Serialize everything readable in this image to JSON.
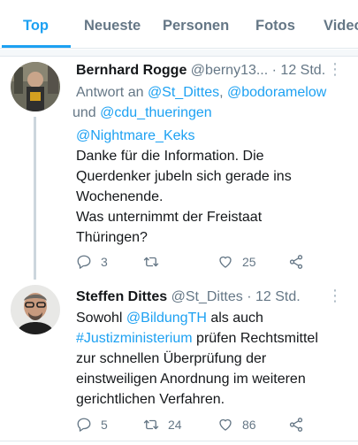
{
  "tabs": [
    {
      "label": "Top",
      "active": true
    },
    {
      "label": "Neueste"
    },
    {
      "label": "Personen"
    },
    {
      "label": "Fotos"
    },
    {
      "label": "Videos"
    }
  ],
  "tweets": [
    {
      "name": "Bernhard Rogge",
      "handle": "@berny13...",
      "time": "· 12 Std.",
      "more": "⋮",
      "reply_prefix": "Antwort an ",
      "reply_to": [
        "@St_Dittes",
        "@bodoramelow",
        "@cdu_thueringen"
      ],
      "reply_sep": ", ",
      "reply_and": " und ",
      "mention": "@Nightmare_Keks",
      "text_lines": [
        "Danke für die Information. Die",
        "Querdenker jubeln sich gerade ins",
        "Wochenende.",
        "Was unternimmt der Freistaat",
        "Thüringen?"
      ],
      "replies": "3",
      "retweets": "",
      "likes": "25"
    },
    {
      "name": "Steffen Dittes",
      "handle": "@St_Dittes",
      "time": "· 12 Std.",
      "more": "⋮",
      "text_prefix": "Sowohl ",
      "mention": "@BildungTH",
      "text_mid": " als auch",
      "hashtag": "#Justizministerium",
      "text_after_hashtag": " prüfen Rechtsmittel",
      "text_lines": [
        "zur schnellen Überprüfung der",
        "einstweiligen Anordnung im weiteren",
        "gerichtlichen Verfahren."
      ],
      "replies": "5",
      "retweets": "24",
      "likes": "86"
    }
  ],
  "icons": [
    "reply-icon",
    "retweet-icon",
    "like-icon",
    "share-icon"
  ],
  "colors": {
    "accent": "#1da1f2",
    "muted": "#657786"
  }
}
